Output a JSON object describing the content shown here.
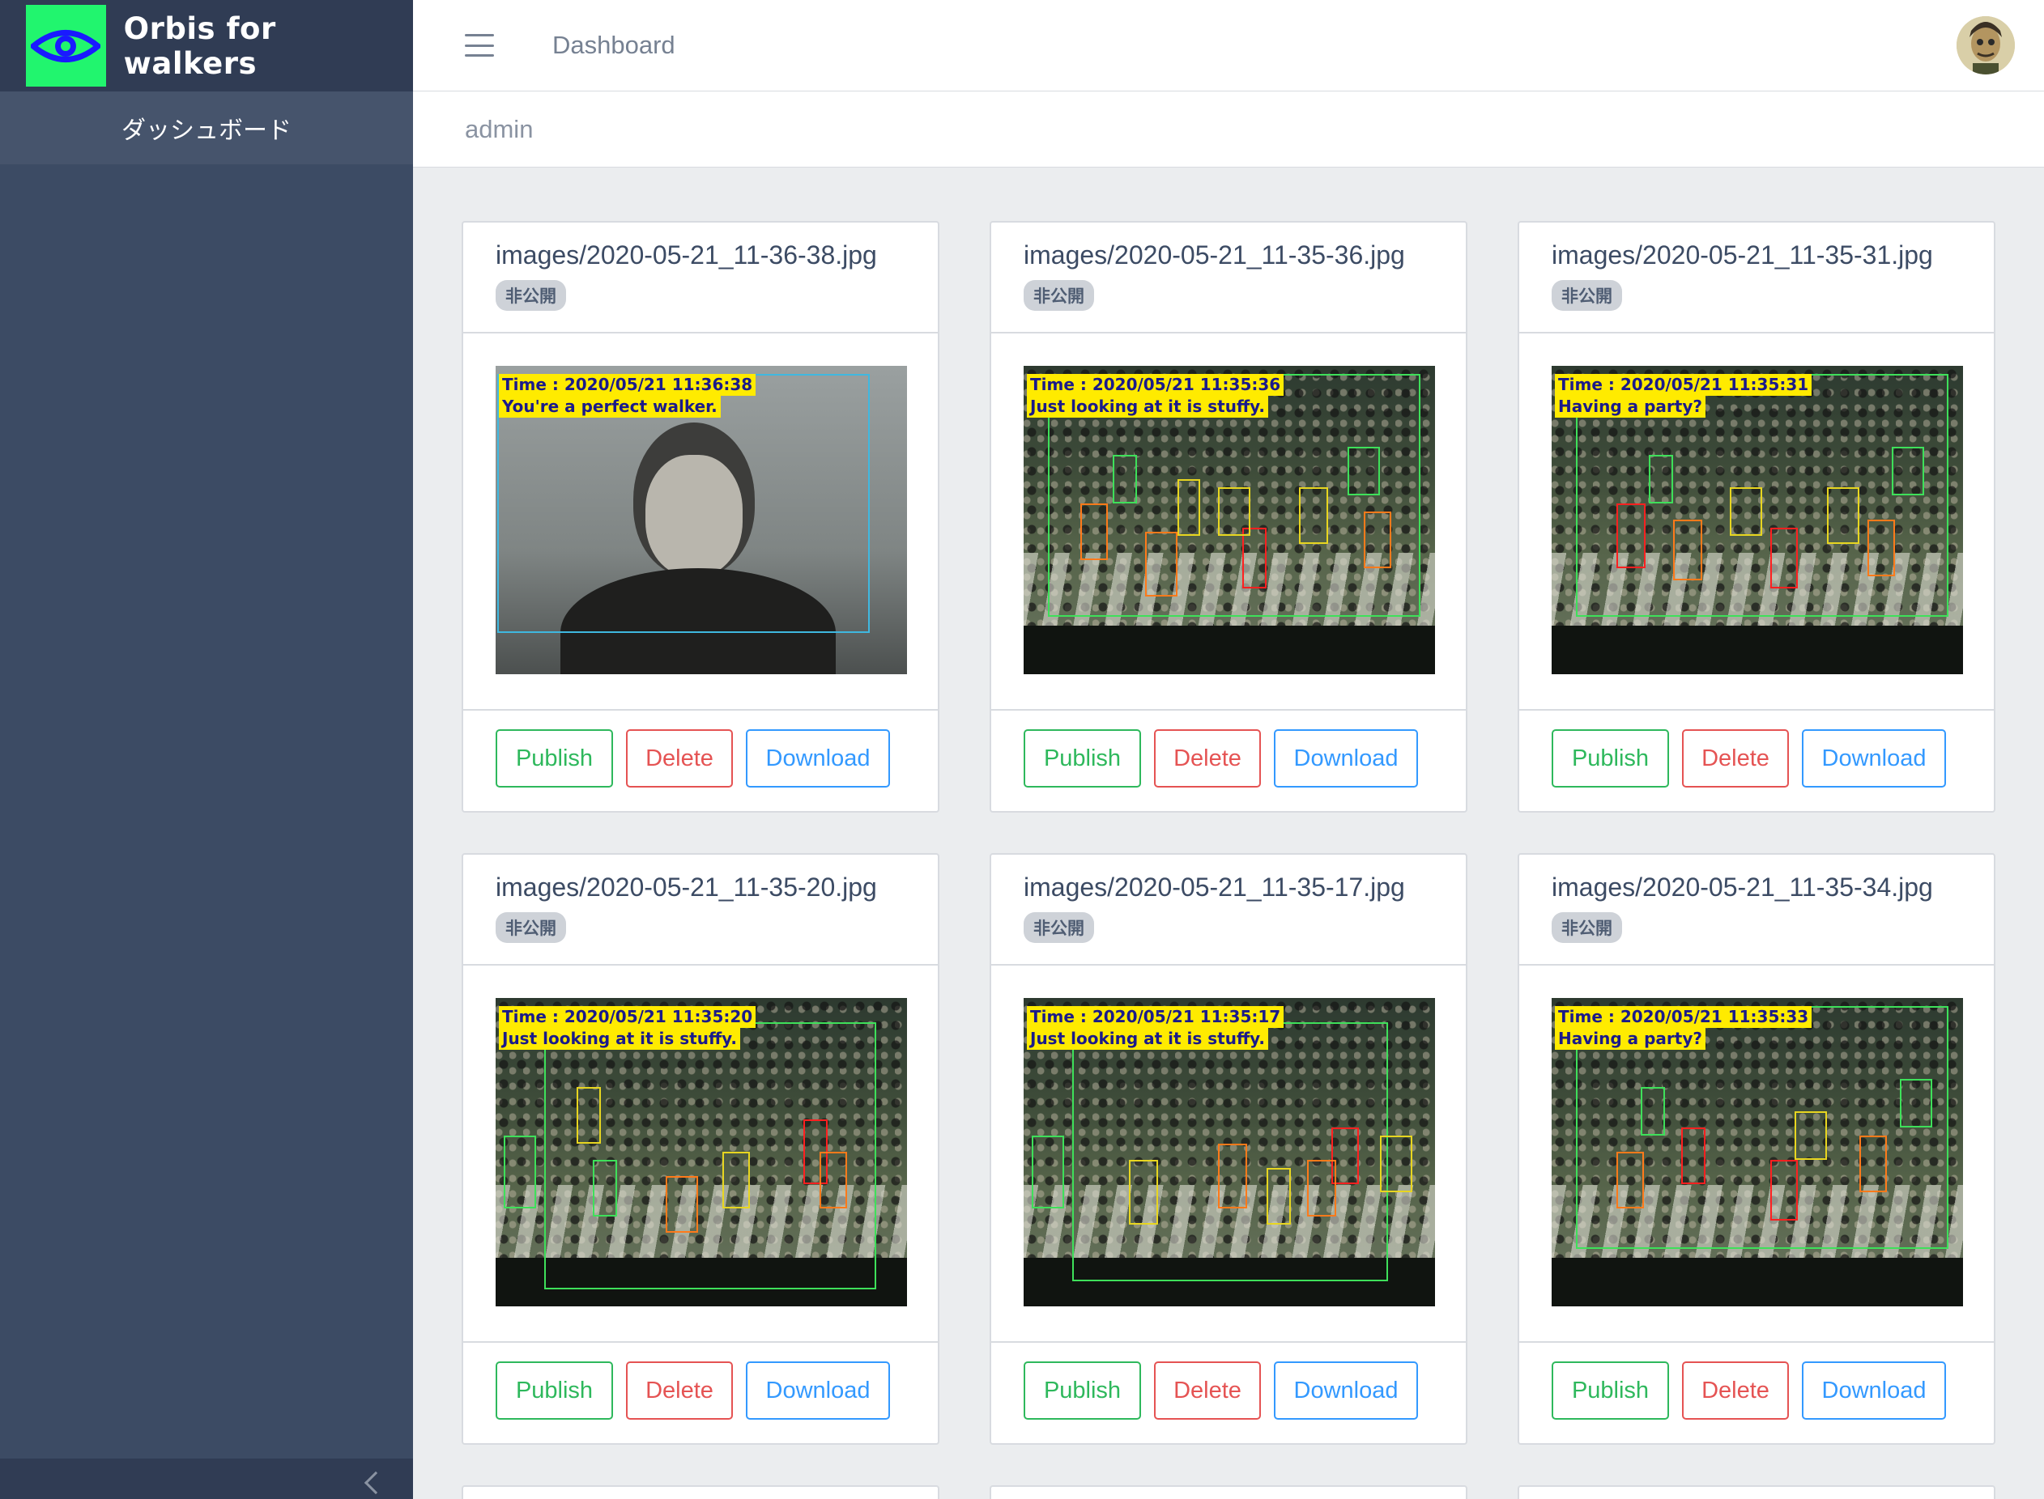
{
  "app": {
    "brand_name": "Orbis for walkers",
    "brand_color": "#21f56e",
    "sidebar_color": "#3c4b64"
  },
  "sidebar": {
    "items": [
      {
        "label": "ダッシュボード"
      }
    ]
  },
  "header": {
    "menu_icon": "hamburger-icon",
    "nav_link": "Dashboard",
    "avatar": "user-avatar"
  },
  "breadcrumb": {
    "current": "admin"
  },
  "cards": [
    {
      "filename": "images/2020-05-21_11-36-38.jpg",
      "status": "非公開",
      "caption_time": "Time : 2020/05/21 11:36:38",
      "caption_text": "You're a perfect walker.",
      "publish": "Publish",
      "delete": "Delete",
      "download": "Download"
    },
    {
      "filename": "images/2020-05-21_11-35-36.jpg",
      "status": "非公開",
      "caption_time": "Time : 2020/05/21 11:35:36",
      "caption_text": "Just looking at it is stuffy.",
      "publish": "Publish",
      "delete": "Delete",
      "download": "Download"
    },
    {
      "filename": "images/2020-05-21_11-35-31.jpg",
      "status": "非公開",
      "caption_time": "Time : 2020/05/21 11:35:31",
      "caption_text": "Having a party?",
      "publish": "Publish",
      "delete": "Delete",
      "download": "Download"
    },
    {
      "filename": "images/2020-05-21_11-35-20.jpg",
      "status": "非公開",
      "caption_time": "Time : 2020/05/21 11:35:20",
      "caption_text": "Just looking at it is stuffy.",
      "publish": "Publish",
      "delete": "Delete",
      "download": "Download"
    },
    {
      "filename": "images/2020-05-21_11-35-17.jpg",
      "status": "非公開",
      "caption_time": "Time : 2020/05/21 11:35:17",
      "caption_text": "Just looking at it is stuffy.",
      "publish": "Publish",
      "delete": "Delete",
      "download": "Download"
    },
    {
      "filename": "images/2020-05-21_11-35-34.jpg",
      "status": "非公開",
      "caption_time": "Time : 2020/05/21 11:35:33",
      "caption_text": "Having a party?",
      "publish": "Publish",
      "delete": "Delete",
      "download": "Download"
    }
  ],
  "button_colors": {
    "publish": "#2eb85c",
    "delete": "#e55353",
    "download": "#3399ff"
  }
}
